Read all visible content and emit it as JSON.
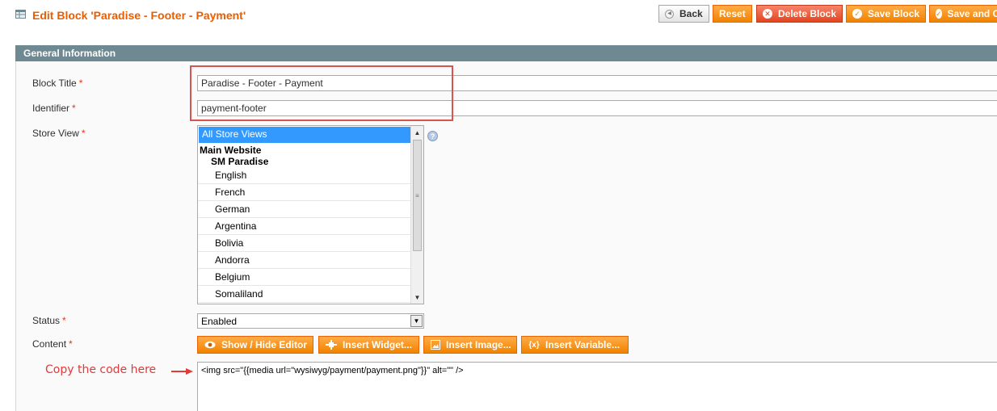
{
  "header": {
    "title": "Edit Block 'Paradise - Footer - Payment'",
    "buttons": {
      "back": "Back",
      "reset": "Reset",
      "delete": "Delete Block",
      "save": "Save Block",
      "save_continue": "Save and C"
    }
  },
  "section": {
    "title": "General Information"
  },
  "form": {
    "block_title": {
      "label": "Block Title",
      "value": "Paradise - Footer - Payment"
    },
    "identifier": {
      "label": "Identifier",
      "value": "payment-footer"
    },
    "store_view": {
      "label": "Store View",
      "selected": "All Store Views",
      "group": "Main Website",
      "subgroup": "SM Paradise",
      "options": [
        "English",
        "French",
        "German",
        "Argentina",
        "Bolivia",
        "Andorra",
        "Belgium",
        "Somaliland"
      ]
    },
    "status": {
      "label": "Status",
      "value": "Enabled"
    },
    "content": {
      "label": "Content",
      "buttons": {
        "show_hide": "Show / Hide Editor",
        "insert_widget": "Insert Widget...",
        "insert_image": "Insert Image...",
        "insert_variable": "Insert Variable..."
      },
      "value": "<img src=\"{{media url=\"wysiwyg/payment/payment.png\"}}\" alt=\"\" />"
    },
    "required_mark": "*"
  },
  "annotation": {
    "text": "Copy the code here"
  },
  "colors": {
    "title": "#eb5e00",
    "section_header": "#6f8992",
    "button_orange": "#f18200",
    "highlight": "#d9534f",
    "annotation": "#e03a3a",
    "selected_option": "#3399ff"
  },
  "icons": [
    "grid-icon",
    "back-arrow-icon",
    "delete-icon",
    "check-icon",
    "help-icon",
    "eye-icon",
    "widget-icon",
    "image-icon",
    "variable-icon",
    "arrow-right-icon"
  ]
}
